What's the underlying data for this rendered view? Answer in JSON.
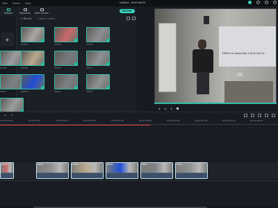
{
  "window": {
    "title": "Untitled : 00:03:46:20",
    "menu": [
      "View",
      "Export",
      "Help"
    ],
    "accent": "#35d7be"
  },
  "library": {
    "tabs": [
      {
        "label": "Effects",
        "icon": "effects-icon"
      },
      {
        "label": "Elements",
        "icon": "elements-icon"
      },
      {
        "label": "Split Screen",
        "icon": "split-screen-icon"
      }
    ],
    "export_label": "EXPORT",
    "record_label": "Record",
    "search_placeholder": "Search media",
    "import_symbol": "+",
    "thumbnails": [
      {
        "label": "00000",
        "tone": "#a9a6a1"
      },
      {
        "label": "00001",
        "tone": "#c96a6a"
      },
      {
        "label": "00003",
        "tone": "#8d8f92"
      },
      {
        "label": "00004",
        "tone": "#9a9c9f"
      },
      {
        "label": "00006",
        "tone": "#b9a88e"
      },
      {
        "label": "00007",
        "tone": "#777a7e"
      },
      {
        "label": "00011",
        "tone": "#8e9195"
      },
      {
        "label": "00012",
        "tone": "#7e8185"
      },
      {
        "label": "00009",
        "tone": "#1f4fd6"
      },
      {
        "label": "00010",
        "tone": "#7c7f83"
      },
      {
        "label": "00021",
        "tone": "#8f9294"
      },
      {
        "label": "00018",
        "tone": "#9a9c9d"
      },
      {
        "label": "00020",
        "tone": "#8a8c8f"
      }
    ]
  },
  "preview": {
    "subtitle": "Děkuji za pozornost a ať je čas na",
    "controls": [
      "prev-frame",
      "play",
      "stop"
    ]
  },
  "timeline": {
    "tools": [
      "undo",
      "redo"
    ],
    "ruler_ticks": [
      "00:00:00:00",
      "00:00:23:05",
      "00:00:46:10",
      "00:01:09:15",
      "00:01:32:20",
      "00:01:56:00",
      "00:02:19:05",
      "00:02:42:10",
      "00:03:05:15",
      "00:03:28:20"
    ],
    "progress_fraction": 0.54,
    "clips": [
      {
        "title": "00001",
        "tone": "#c96a6a"
      },
      {
        "title": "00003",
        "tone": "#8d8f92"
      },
      {
        "title": "00006",
        "tone": "#b9a88e"
      },
      {
        "title": "00009",
        "tone": "#1f4fd6"
      },
      {
        "title": "00012",
        "tone": "#7e8185"
      },
      {
        "title": "00021",
        "tone": "#8f9294"
      }
    ]
  }
}
